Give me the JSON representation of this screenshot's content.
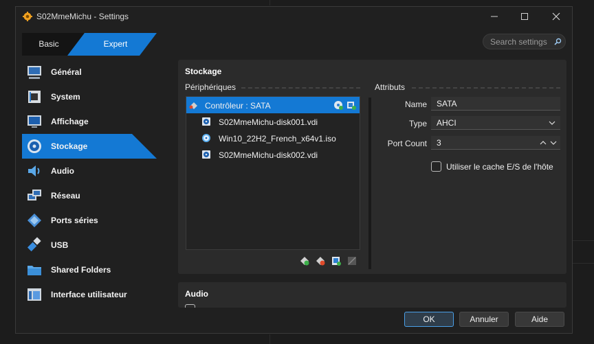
{
  "window": {
    "title": "S02MmeMichu - Settings"
  },
  "mode_tabs": {
    "basic": "Basic",
    "expert": "Expert"
  },
  "search": {
    "placeholder": "Search settings"
  },
  "sidebar": {
    "items": [
      {
        "label": "Général",
        "icon": "monitor-icon"
      },
      {
        "label": "System",
        "icon": "chip-icon"
      },
      {
        "label": "Affichage",
        "icon": "display-icon"
      },
      {
        "label": "Stockage",
        "icon": "disk-icon",
        "active": true
      },
      {
        "label": "Audio",
        "icon": "speaker-icon"
      },
      {
        "label": "Réseau",
        "icon": "network-icon"
      },
      {
        "label": "Ports séries",
        "icon": "serial-port-icon"
      },
      {
        "label": "USB",
        "icon": "usb-icon"
      },
      {
        "label": "Shared Folders",
        "icon": "folder-icon"
      },
      {
        "label": "Interface utilisateur",
        "icon": "ui-window-icon"
      }
    ]
  },
  "storage": {
    "title": "Stockage",
    "devices_heading": "Périphériques",
    "attributes_heading": "Attributs",
    "tree": [
      {
        "label": "Contrôleur : SATA",
        "type": "controller",
        "selected": true
      },
      {
        "label": "S02MmeMichu-disk001.vdi",
        "type": "hard-disk"
      },
      {
        "label": "Win10_22H2_French_x64v1.iso",
        "type": "optical"
      },
      {
        "label": "S02MmeMichu-disk002.vdi",
        "type": "hard-disk"
      }
    ],
    "attributes": {
      "name_label": "Name",
      "name_value": "SATA",
      "type_label": "Type",
      "type_value": "AHCI",
      "port_count_label": "Port Count",
      "port_count_value": "3",
      "cache_label": "Utiliser le cache E/S de l'hôte",
      "cache_checked": false
    }
  },
  "audio_section": {
    "title": "Audio"
  },
  "buttons": {
    "ok": "OK",
    "cancel": "Annuler",
    "help": "Aide"
  },
  "colors": {
    "accent": "#1479d4",
    "window_bg": "#202020",
    "panel_bg": "#2b2b2b"
  }
}
